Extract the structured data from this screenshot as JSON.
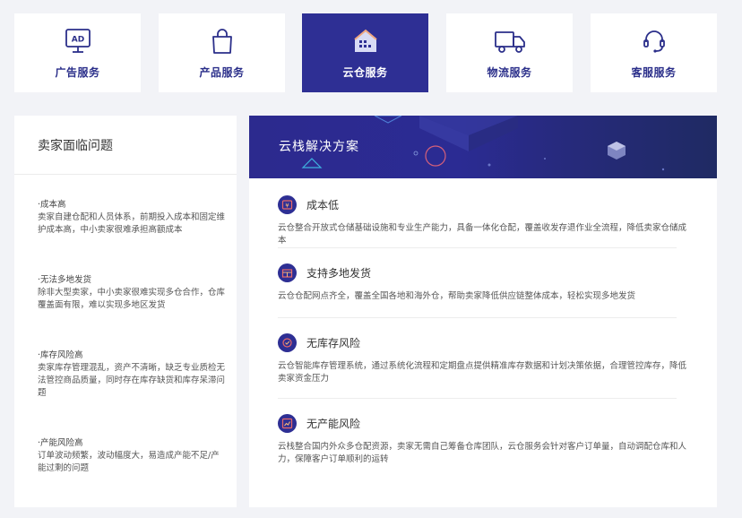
{
  "tabs": [
    {
      "label": "广告服务",
      "icon": "ad-billboard-icon",
      "active": false
    },
    {
      "label": "产品服务",
      "icon": "shopping-bag-icon",
      "active": false
    },
    {
      "label": "云仓服务",
      "icon": "warehouse-icon",
      "active": true
    },
    {
      "label": "物流服务",
      "icon": "delivery-truck-icon",
      "active": false
    },
    {
      "label": "客服服务",
      "icon": "headset-icon",
      "active": false
    }
  ],
  "problems": {
    "title": "卖家面临问题",
    "items": [
      {
        "title": "·成本高",
        "desc": "卖家自建仓配和人员体系，前期投入成本和固定维护成本高，中小卖家很难承担高额成本"
      },
      {
        "title": "·无法多地发货",
        "desc": "除非大型卖家，中小卖家很难实现多仓合作，仓库覆盖面有限，难以实现多地区发货"
      },
      {
        "title": "·库存风险高",
        "desc": "卖家库存管理混乱，资产不清晰，缺乏专业质检无法管控商品质量，同时存在库存缺货和库存呆滞问题"
      },
      {
        "title": "·产能风险高",
        "desc": "订单波动频繁，波动幅度大，易造成产能不足/产能过剩的问题"
      }
    ]
  },
  "solution": {
    "title": "云栈解决方案",
    "features": [
      {
        "title": "成本低",
        "icon": "cost-coin-icon",
        "desc": "云仓整合开放式仓储基础设施和专业生产能力，具备一体化仓配，覆盖收发存退作业全流程，降低卖家仓储成本"
      },
      {
        "title": "支持多地发货",
        "icon": "multi-warehouse-icon",
        "desc": "云仓仓配网点齐全，覆盖全国各地和海外仓，帮助卖家降低供应链整体成本，轻松实现多地发货"
      },
      {
        "title": "无库存风险",
        "icon": "inventory-check-icon",
        "desc": "云仓智能库存管理系统，通过系统化流程和定期盘点提供精准库存数据和计划决策依据，合理管控库存，降低卖家资金压力"
      },
      {
        "title": "无产能风险",
        "icon": "capacity-chart-icon",
        "desc": "云栈整合国内外众多仓配资源，卖家无需自己筹备仓库团队，云仓服务会针对客户订单量，自动调配仓库和人力，保障客户订单顺利的运转"
      }
    ]
  },
  "colors": {
    "accent": "#2e2f94",
    "tab_label": "#2b2f8a",
    "background": "#f2f3f7"
  }
}
